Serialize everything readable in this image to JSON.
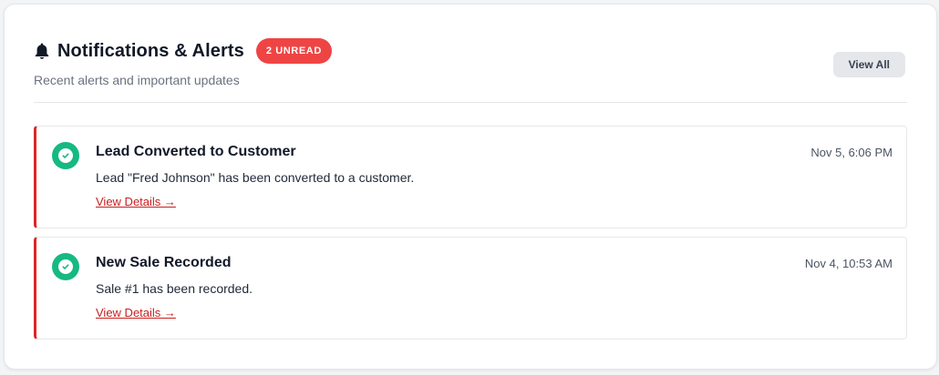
{
  "header": {
    "icon": "bell-icon",
    "title": "Notifications & Alerts",
    "badge": "2 UNREAD",
    "subtitle": "Recent alerts and important updates",
    "view_all_label": "View All"
  },
  "notifications": [
    {
      "icon": "check-circle-icon",
      "title": "Lead Converted to Customer",
      "time": "Nov 5, 6:06 PM",
      "message": "Lead \"Fred Johnson\" has been converted to a customer.",
      "link_label": "View Details →"
    },
    {
      "icon": "check-circle-icon",
      "title": "New Sale Recorded",
      "time": "Nov 4, 10:53 AM",
      "message": "Sale #1 has been recorded.",
      "link_label": "View Details →"
    }
  ],
  "colors": {
    "accent_red": "#dc2626",
    "badge_red": "#ef4444",
    "success_green": "#16b981",
    "link_red": "#c81e1e"
  }
}
